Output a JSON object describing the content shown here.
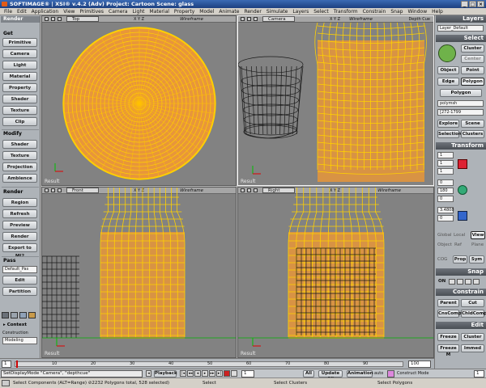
{
  "titlebar": {
    "title": "SOFTIMAGE® | XSI® v.4.2 (Adv) Project: Cartoon    Scene: glass"
  },
  "menu": [
    "File",
    "Edit",
    "Application",
    "View",
    "Primitives",
    "Camera",
    "Light",
    "Material",
    "Property",
    "Model",
    "Animate",
    "Render",
    "Simulate",
    "Layers",
    "Select",
    "Transform",
    "Constrain",
    "Snap",
    "Window",
    "Help"
  ],
  "left_toolbar": {
    "render_header": "Render",
    "get_header": "Get",
    "get_buttons": [
      "Primitive",
      "Camera",
      "Light",
      "Material",
      "Property",
      "Shader",
      "Texture",
      "Clip"
    ],
    "modify_header": "Modify",
    "modify_buttons": [
      "Shader",
      "Texture",
      "Projection",
      "Ambience"
    ],
    "render_section_header": "Render",
    "render_buttons": [
      "Region",
      "Refresh",
      "Preview",
      "Render",
      "Export to MI2"
    ],
    "pass_header": "Pass",
    "pass_value": "Default_Pas",
    "pass_buttons": [
      "Edit",
      "Partition"
    ],
    "context_label": "Context",
    "construction_label": "Construction Mode",
    "construction_value": "Modeling"
  },
  "viewports": [
    {
      "view": "Top",
      "mode": "Wireframe",
      "axes": "X Y Z",
      "result": "Result"
    },
    {
      "view": "Camera",
      "mode": "Wireframe",
      "axes": "X Y Z",
      "depth": "Depth Cue",
      "result": "Result"
    },
    {
      "view": "Front",
      "mode": "Wireframe",
      "axes": "X Y Z",
      "result": "Result"
    },
    {
      "view": "Right",
      "mode": "Wireframe",
      "axes": "X Y Z",
      "result": "Result"
    }
  ],
  "right_panel": {
    "layers_header": "Layers",
    "layer_value": "Layer_Default",
    "select_header": "Select",
    "cluster_label": "Cluster",
    "center_label": "Center",
    "object_label": "Object",
    "point_label": "Point",
    "edge_label": "Edge",
    "polygon_label": "Polygon",
    "polygon_btn": "Polygon",
    "polymsh_value": "polymsh",
    "range_value": "[272-1799",
    "explore_label": "Explore",
    "scene_label": "Scene",
    "selection_label": "Selection",
    "clusters_label": "Clusters",
    "transform_header": "Transform",
    "transform_values": [
      "1",
      "1",
      "1",
      "0",
      "180",
      "0",
      "3.4808",
      "0"
    ],
    "global_label": "Global",
    "local_label": "Local",
    "view_label": "View",
    "object_label2": "Object",
    "ref_label": "Ref",
    "plane_label": "Plane",
    "cog_label": "COG",
    "prop_label": "Prop",
    "sym_label": "Sym",
    "snap_header": "Snap",
    "snap_on": "ON",
    "constrain_header": "Constrain",
    "parent_label": "Parent",
    "cut_label": "Cut",
    "cnscomp_label": "CnsComp",
    "chldcomp_label": "ChldComp",
    "edit_header": "Edit",
    "freeze_label": "Freeze",
    "cluster2_label": "Cluster",
    "freezem_label": "Freeze M",
    "immed_label": "Immed"
  },
  "timeline": {
    "start": "1",
    "ticks": [
      "10",
      "20",
      "30",
      "40",
      "50",
      "60",
      "70",
      "80",
      "90"
    ],
    "end": "100"
  },
  "bottom": {
    "command": "SetDisplayMode \"Camera\", \"depthcue\"",
    "playback": "Playback",
    "frame": "1",
    "all": "All",
    "update_all": "Update All",
    "animation": "Animation",
    "auto": "auto",
    "key_label": "Construct Mode",
    "current_frame": "1"
  },
  "status": {
    "left": "Select Components (ALT=Range)  ⊘2232 Polygons total, 528 selected)",
    "mid1": "Select",
    "mid2": "Select Clusters",
    "right": "Select Polygons"
  }
}
